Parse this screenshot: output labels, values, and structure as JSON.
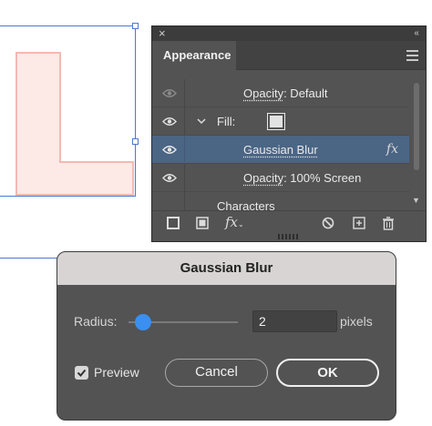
{
  "panel": {
    "title": "Appearance",
    "close_glyph": "×",
    "collapse_glyph": "‹‹",
    "rows": {
      "opacity_default_label": "Opacity",
      "opacity_default_value": ": Default",
      "fill_label": "Fill:",
      "gaussian_label": "Gaussian Blur",
      "fx_glyph": "fx",
      "opacity_screen_label": "Opacity",
      "opacity_screen_value": ": 100% Screen",
      "characters_label": "Characters"
    },
    "bottom_icons": [
      "new-art-stroke-icon",
      "new-art-fill-icon",
      "add-effect-icon",
      "clear-appearance-icon",
      "duplicate-item-icon",
      "delete-item-icon"
    ],
    "fx_button_label": "fx"
  },
  "dialog": {
    "title": "Gaussian Blur",
    "radius_label": "Radius:",
    "radius_value": "2",
    "radius_slider_fraction": 0.05,
    "unit_label": "pixels",
    "preview_label": "Preview",
    "preview_checked": true,
    "cancel_label": "Cancel",
    "ok_label": "OK"
  },
  "colors": {
    "accent": "#3a8ff0",
    "selection_blue": "#4a78d6",
    "selected_row": "#4b6584",
    "letter_fill": "#fde9e6",
    "letter_stroke": "#f3b9b0"
  }
}
